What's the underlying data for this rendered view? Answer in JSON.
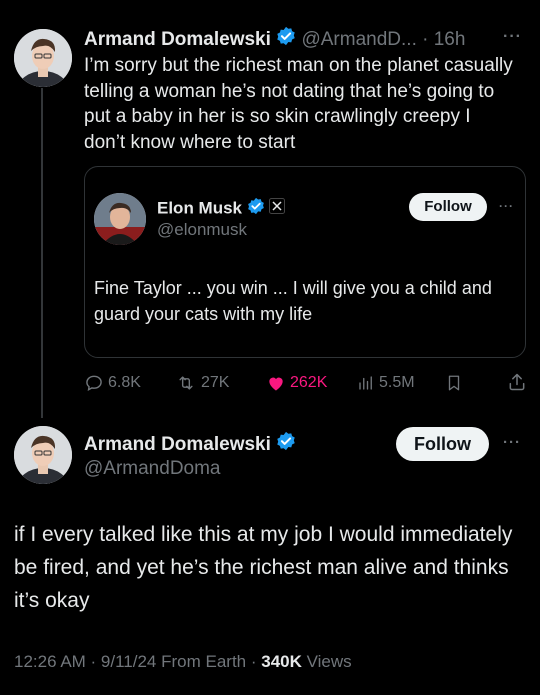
{
  "tweet": {
    "author_name": "Armand Domalewski",
    "handle_time": "@ArmandD... · 16h",
    "text": "I’m sorry but the richest man on the planet casually telling a woman he’s not dating that he’s going to put a baby in her is so skin crawlingly creepy I don’t know where to start",
    "more": "···",
    "quote": {
      "author_name": "Elon Musk",
      "handle": "@elonmusk",
      "follow_label": "Follow",
      "more": "···",
      "text": "Fine Taylor ... you win ... I will give you a child and guard your cats with my life"
    },
    "actions": {
      "replies": "6.8K",
      "retweets": "27K",
      "likes": "262K",
      "views": "5.5M"
    }
  },
  "reply": {
    "author_name": "Armand Domalewski",
    "handle": "@ArmandDoma",
    "follow_label": "Follow",
    "more": "···",
    "text": "if I every talked like this at my job I would immediately be fired, and  yet he’s the richest man alive and thinks it’s okay",
    "time_date": "12:26 AM · 9/11/24 From Earth · ",
    "views_count": "340K",
    "views_label": " Views"
  },
  "colors": {
    "verified_blue": "#1d9bf0",
    "like_pink": "#f91880",
    "muted": "#71767b",
    "follow_bg": "#eff3f4"
  }
}
